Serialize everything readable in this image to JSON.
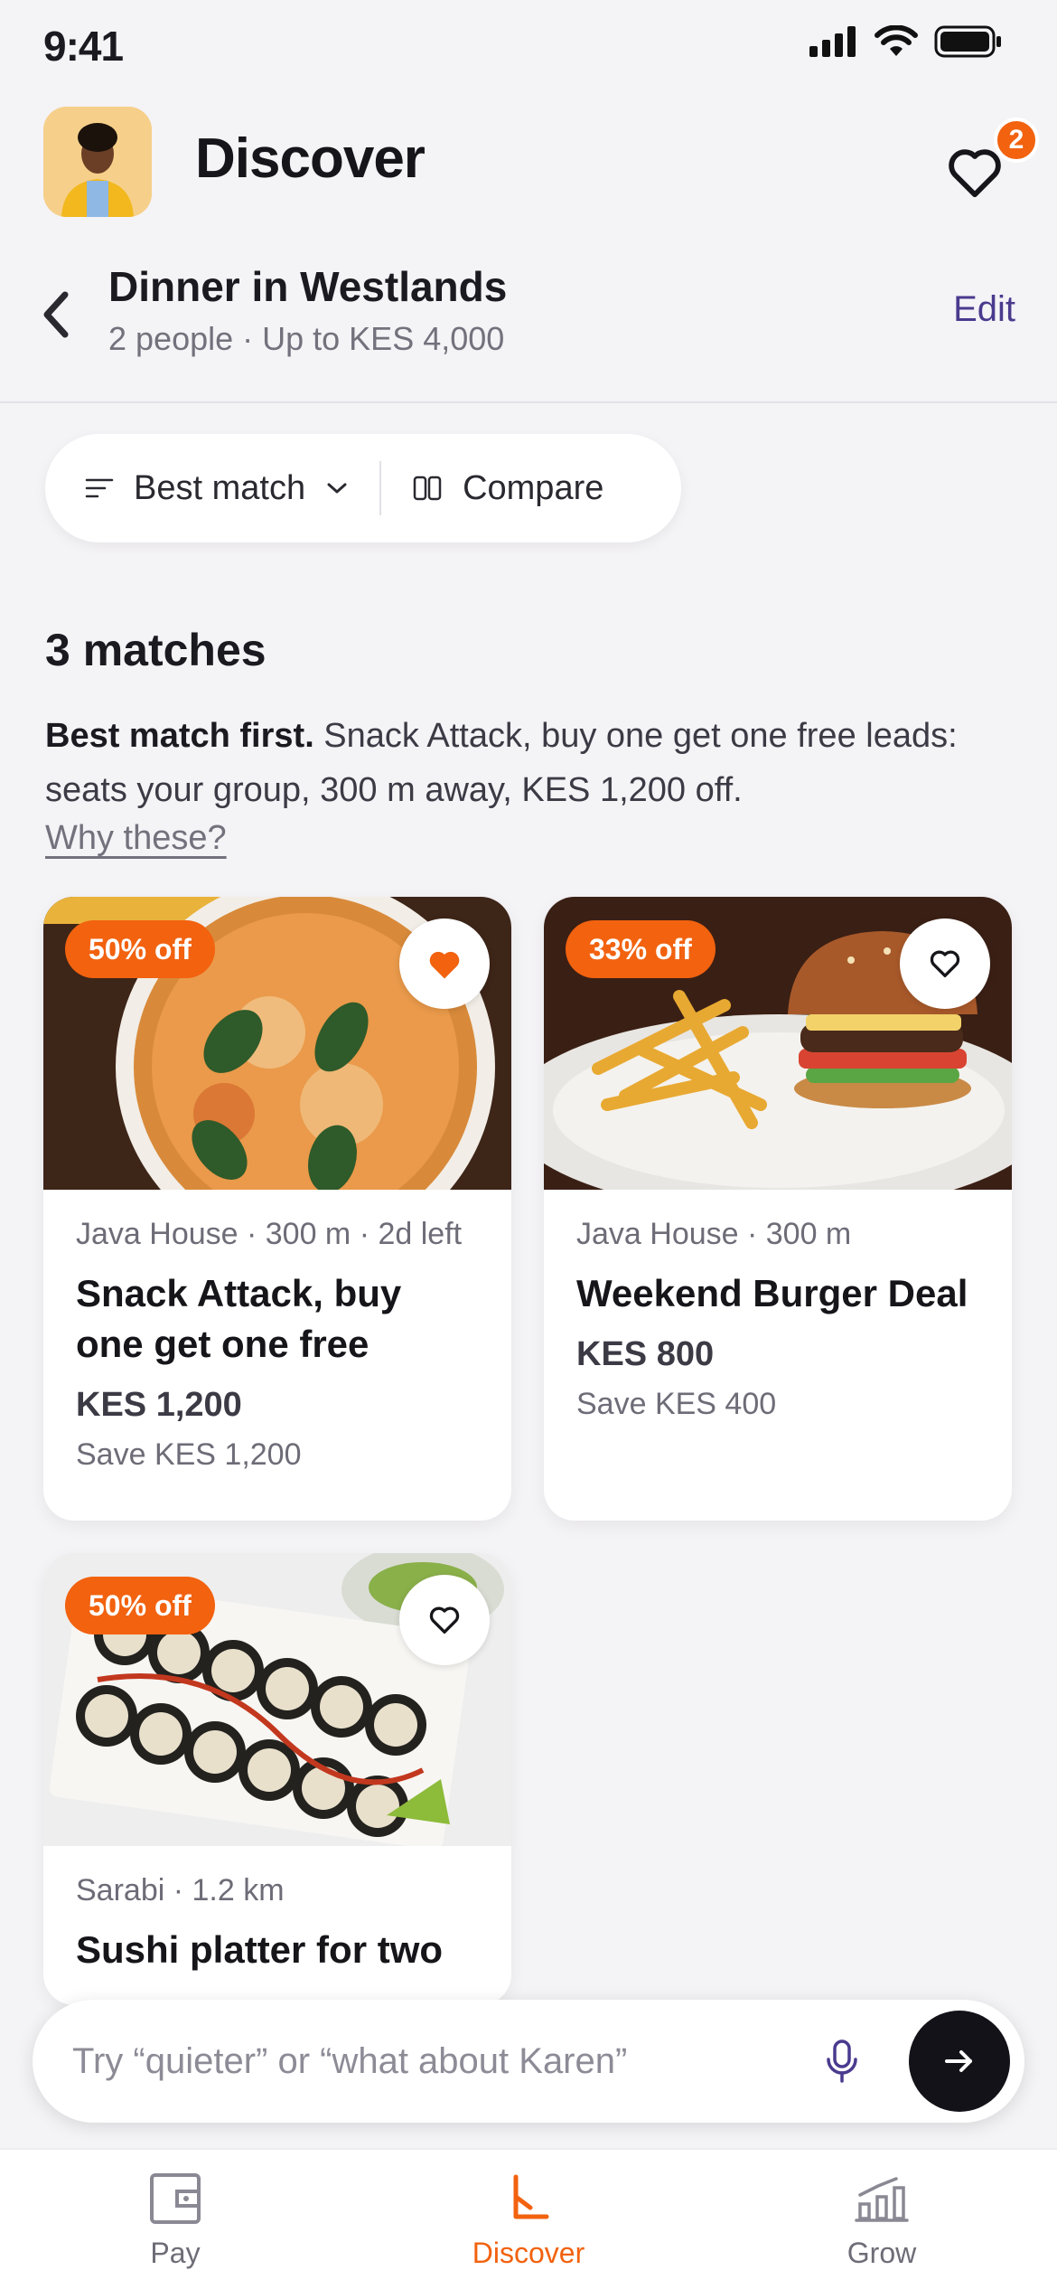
{
  "status_bar": {
    "time": "9:41"
  },
  "header": {
    "title": "Discover",
    "favorites_count": "2"
  },
  "context": {
    "title": "Dinner in Westlands",
    "subtitle": "2 people · Up to KES 4,000",
    "edit_label": "Edit"
  },
  "toolbar": {
    "sort_label": "Best match",
    "compare_label": "Compare"
  },
  "results": {
    "count_label": "3 matches",
    "summary_bold": "Best match first.",
    "summary_rest": " Snack Attack, buy one get one free leads: seats your group, 300 m away, KES 1,200 off.",
    "why_label": "Why these?"
  },
  "deals": [
    {
      "badge": "50% off",
      "meta": "Java House · 300 m · 2d left",
      "title": "Snack Attack, buy one get one free",
      "price": "KES 1,200",
      "save": "Save KES 1,200",
      "favorited": true
    },
    {
      "badge": "33% off",
      "meta": "Java House · 300 m",
      "title": "Weekend Burger Deal",
      "price": "KES 800",
      "save": "Save KES 400",
      "favorited": false
    },
    {
      "badge": "50% off",
      "meta": "Sarabi · 1.2 km",
      "title": "Sushi platter for two",
      "favorited": false
    }
  ],
  "ask": {
    "placeholder": "Try “quieter” or “what about Karen”"
  },
  "nav": [
    {
      "label": "Pay",
      "icon": "wallet-icon"
    },
    {
      "label": "Discover",
      "icon": "discover-icon",
      "active": true
    },
    {
      "label": "Grow",
      "icon": "growth-chart-icon"
    }
  ],
  "colors": {
    "accent": "#f2620f",
    "link": "#4a3a8e",
    "dark": "#121218"
  }
}
